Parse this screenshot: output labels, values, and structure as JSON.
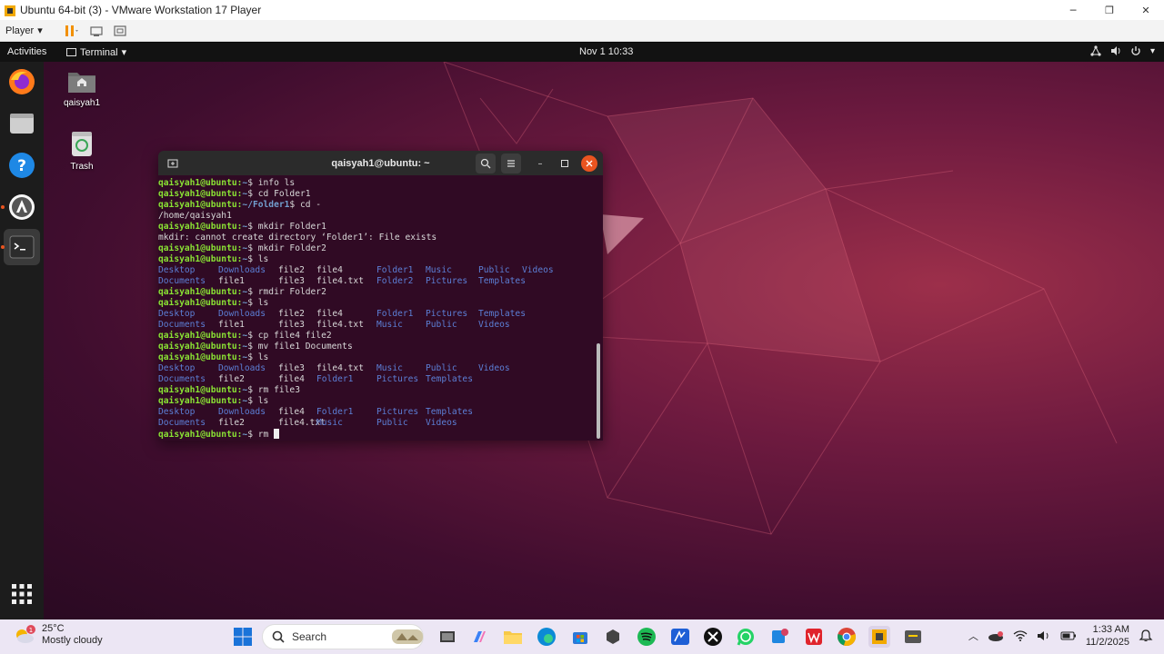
{
  "vm_window": {
    "title": "Ubuntu 64-bit (3) - VMware Workstation 17 Player",
    "controls": [
      "minimize",
      "restore",
      "close"
    ],
    "toolbar": {
      "player_label": "Player"
    }
  },
  "ubuntu_topbar": {
    "activities": "Activities",
    "app_menu": "Terminal",
    "clock": "Nov 1  10:33"
  },
  "dock": {
    "items": [
      "firefox-icon",
      "files-icon",
      "help-icon",
      "software-icon",
      "terminal-icon",
      "app-grid-icon"
    ]
  },
  "desktop": {
    "icons": [
      {
        "label": "qaisyah1",
        "icon": "home-folder-icon"
      },
      {
        "label": "Trash",
        "icon": "trash-icon"
      }
    ]
  },
  "terminal": {
    "title": "qaisyah1@ubuntu: ~",
    "prompt_user": "qaisyah1@ubuntu:",
    "lines": [
      {
        "kind": "cmd",
        "path": "~",
        "cmd": " info ls"
      },
      {
        "kind": "cmd",
        "path": "~",
        "cmd": " cd Folder1"
      },
      {
        "kind": "cmd",
        "path": "~/Folder1",
        "cmd": " cd -"
      },
      {
        "kind": "out",
        "text": "/home/qaisyah1"
      },
      {
        "kind": "cmd",
        "path": "~",
        "cmd": " mkdir Folder1"
      },
      {
        "kind": "out",
        "text": "mkdir: cannot create directory ‘Folder1’: File exists"
      },
      {
        "kind": "cmd",
        "path": "~",
        "cmd": " mkdir Folder2"
      },
      {
        "kind": "cmd",
        "path": "~",
        "cmd": " ls"
      },
      {
        "kind": "ls",
        "items": [
          [
            "Desktop",
            "dir"
          ],
          [
            "Downloads",
            "dir"
          ],
          [
            "file2",
            "file"
          ],
          [
            "file4",
            "file"
          ],
          [
            "Folder1",
            "dir"
          ],
          [
            "Music",
            "dir"
          ],
          [
            "Public",
            "dir"
          ],
          [
            "Videos",
            "dir"
          ]
        ]
      },
      {
        "kind": "ls",
        "items": [
          [
            "Documents",
            "dir"
          ],
          [
            "file1",
            "file"
          ],
          [
            "file3",
            "file"
          ],
          [
            "file4.txt",
            "file"
          ],
          [
            "Folder2",
            "dir"
          ],
          [
            "Pictures",
            "dir"
          ],
          [
            "Templates",
            "dir"
          ]
        ]
      },
      {
        "kind": "cmd",
        "path": "~",
        "cmd": " rmdir Folder2"
      },
      {
        "kind": "cmd",
        "path": "~",
        "cmd": " ls"
      },
      {
        "kind": "ls",
        "items": [
          [
            "Desktop",
            "dir"
          ],
          [
            "Downloads",
            "dir"
          ],
          [
            "file2",
            "file"
          ],
          [
            "file4",
            "file"
          ],
          [
            "Folder1",
            "dir"
          ],
          [
            "Pictures",
            "dir"
          ],
          [
            "Templates",
            "dir"
          ]
        ]
      },
      {
        "kind": "ls",
        "items": [
          [
            "Documents",
            "dir"
          ],
          [
            "file1",
            "file"
          ],
          [
            "file3",
            "file"
          ],
          [
            "file4.txt",
            "file"
          ],
          [
            "Music",
            "dir"
          ],
          [
            "Public",
            "dir"
          ],
          [
            "Videos",
            "dir"
          ]
        ]
      },
      {
        "kind": "cmd",
        "path": "~",
        "cmd": " cp file4 file2"
      },
      {
        "kind": "cmd",
        "path": "~",
        "cmd": " mv file1 Documents"
      },
      {
        "kind": "cmd",
        "path": "~",
        "cmd": " ls"
      },
      {
        "kind": "ls",
        "items": [
          [
            "Desktop",
            "dir"
          ],
          [
            "Downloads",
            "dir"
          ],
          [
            "file3",
            "file"
          ],
          [
            "file4.txt",
            "file"
          ],
          [
            "Music",
            "dir"
          ],
          [
            "Public",
            "dir"
          ],
          [
            "Videos",
            "dir"
          ]
        ]
      },
      {
        "kind": "ls",
        "items": [
          [
            "Documents",
            "dir"
          ],
          [
            "file2",
            "file"
          ],
          [
            "file4",
            "file"
          ],
          [
            "Folder1",
            "dir"
          ],
          [
            "Pictures",
            "dir"
          ],
          [
            "Templates",
            "dir"
          ]
        ]
      },
      {
        "kind": "cmd",
        "path": "~",
        "cmd": " rm file3"
      },
      {
        "kind": "cmd",
        "path": "~",
        "cmd": " ls"
      },
      {
        "kind": "ls",
        "items": [
          [
            "Desktop",
            "dir"
          ],
          [
            "Downloads",
            "dir"
          ],
          [
            "file4",
            "file"
          ],
          [
            "Folder1",
            "dir"
          ],
          [
            "Pictures",
            "dir"
          ],
          [
            "Templates",
            "dir"
          ]
        ]
      },
      {
        "kind": "ls",
        "items": [
          [
            "Documents",
            "dir"
          ],
          [
            "file2",
            "file"
          ],
          [
            "file4.txt",
            "file"
          ],
          [
            "Music",
            "dir"
          ],
          [
            "Public",
            "dir"
          ],
          [
            "Videos",
            "dir"
          ]
        ]
      },
      {
        "kind": "current",
        "path": "~",
        "cmd": " rm "
      }
    ]
  },
  "taskbar": {
    "weather_temp": "25°C",
    "weather_desc": "Mostly cloudy",
    "weather_badge": "1",
    "search_placeholder": "Search",
    "time": "1:33 AM",
    "date": "11/2/2025",
    "apps": [
      "widgets-icon",
      "task-view-icon",
      "copilot-icon",
      "file-explorer-icon",
      "edge-icon",
      "store-icon",
      "app-icon",
      "spotify-icon",
      "app-icon-2",
      "xbox-icon",
      "whatsapp-icon",
      "app-icon-3",
      "wps-icon",
      "chrome-icon",
      "vmware-icon",
      "app-icon-4"
    ]
  }
}
